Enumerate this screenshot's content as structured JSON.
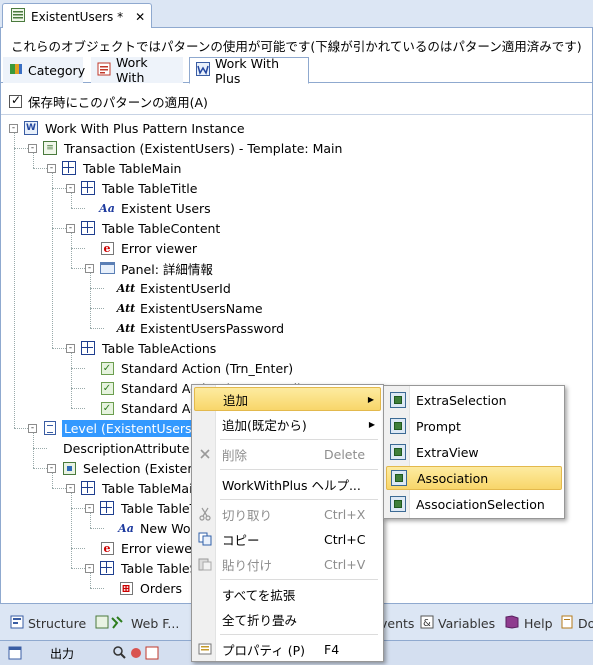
{
  "doc_tab": {
    "title": "ExistentUsers *",
    "close": "✕"
  },
  "description": "これらのオブジェクトではパターンの使用が可能です(下線が引かれているのはパターン適用済みです)",
  "pattern_tabs": [
    {
      "label": "Category",
      "icon": "category-icon"
    },
    {
      "label": "Work With",
      "icon": "workwith-icon"
    },
    {
      "label": "Work With Plus",
      "icon": "workwithplus-icon",
      "active": true
    }
  ],
  "apply_on_save": {
    "label": "保存時にこのパターンの適用(A)",
    "checked": true
  },
  "tree": [
    {
      "label": "Work With Plus Pattern Instance",
      "icon": "pattern-instance-icon",
      "level": 0,
      "expander": "-"
    },
    {
      "label": "Transaction (ExistentUsers) - Template: Main",
      "icon": "transaction-icon",
      "level": 1,
      "expander": "-"
    },
    {
      "label": "Table TableMain",
      "icon": "table-icon",
      "level": 2,
      "expander": "-"
    },
    {
      "label": "Table TableTitle",
      "icon": "table-icon",
      "level": 3,
      "expander": "-"
    },
    {
      "label": "Existent Users",
      "icon": "text-block-icon",
      "level": 4
    },
    {
      "label": "Table TableContent",
      "icon": "table-icon",
      "level": 3,
      "expander": "-"
    },
    {
      "label": "Error viewer",
      "icon": "error-viewer-icon",
      "level": 4
    },
    {
      "label": "Panel: 詳細情報",
      "icon": "panel-icon",
      "level": 4,
      "expander": "-"
    },
    {
      "label": "ExistentUserId",
      "icon": "attribute-icon",
      "level": 5
    },
    {
      "label": "ExistentUsersName",
      "icon": "attribute-icon",
      "level": 5
    },
    {
      "label": "ExistentUsersPassword",
      "icon": "attribute-icon",
      "level": 5
    },
    {
      "label": "Table TableActions",
      "icon": "table-icon",
      "level": 3,
      "expander": "-"
    },
    {
      "label": "Standard Action (Trn_Enter)",
      "icon": "action-icon",
      "level": 4
    },
    {
      "label": "Standard Action (Trn_Cancel)",
      "icon": "action-icon",
      "level": 4
    },
    {
      "label": "Standard Action (Trn_Delete)",
      "icon": "action-icon",
      "level": 4
    },
    {
      "label": "Level (ExistentUsers)",
      "icon": "level-icon",
      "level": 1,
      "expander": "-",
      "selected": true
    },
    {
      "label": "DescriptionAttribute (ExistentUsersName)",
      "icon": "",
      "level": 2
    },
    {
      "label": "Selection (ExistentUsers)",
      "icon": "selection-icon",
      "level": 2,
      "expander": "-"
    },
    {
      "label": "Table TableMain",
      "icon": "table-icon",
      "level": 3,
      "expander": "-"
    },
    {
      "label": "Table TableTop",
      "icon": "table-icon",
      "level": 4,
      "expander": "-"
    },
    {
      "label": "New Workflow",
      "icon": "text-block-icon",
      "level": 5
    },
    {
      "label": "Error viewer",
      "icon": "error-viewer-icon",
      "level": 4
    },
    {
      "label": "Table TableSearch",
      "icon": "table-icon",
      "level": 4,
      "expander": "-"
    },
    {
      "label": "Orders",
      "icon": "orders-icon",
      "level": 5
    }
  ],
  "context_menu": [
    {
      "label": "追加",
      "submenu": true,
      "hot": true
    },
    {
      "label": "追加(既定から)",
      "submenu": true
    },
    {
      "sep": true
    },
    {
      "label": "削除",
      "shortcut": "Delete",
      "disabled": true,
      "icon": "delete-icon"
    },
    {
      "sep": true
    },
    {
      "label": "WorkWithPlus ヘルプ..."
    },
    {
      "sep": true
    },
    {
      "label": "切り取り",
      "shortcut": "Ctrl+X",
      "disabled": true,
      "icon": "cut-icon"
    },
    {
      "label": "コピー",
      "shortcut": "Ctrl+C",
      "icon": "copy-icon"
    },
    {
      "label": "貼り付け",
      "shortcut": "Ctrl+V",
      "disabled": true,
      "icon": "paste-icon"
    },
    {
      "sep": true
    },
    {
      "label": "すべてを拡張"
    },
    {
      "label": "全て折り畳み"
    },
    {
      "sep": true
    },
    {
      "label": "プロパティ (P)",
      "shortcut": "F4",
      "icon": "properties-icon"
    }
  ],
  "submenu": [
    {
      "label": "ExtraSelection"
    },
    {
      "label": "Prompt"
    },
    {
      "label": "ExtraView"
    },
    {
      "label": "Association",
      "hot": true
    },
    {
      "label": "AssociationSelection"
    }
  ],
  "bottom_tabs": [
    {
      "label": "Structure",
      "icon": "structure-icon"
    },
    {
      "label": "Web F...",
      "icon": "webform-icon"
    },
    {
      "label": "vents",
      "icon": ""
    },
    {
      "label": "Variables",
      "icon": "variables-icon"
    },
    {
      "label": "Help",
      "icon": "help-icon"
    },
    {
      "label": "Do",
      "icon": "documentation-icon"
    }
  ],
  "status_bar": {
    "output_label": "出力"
  }
}
